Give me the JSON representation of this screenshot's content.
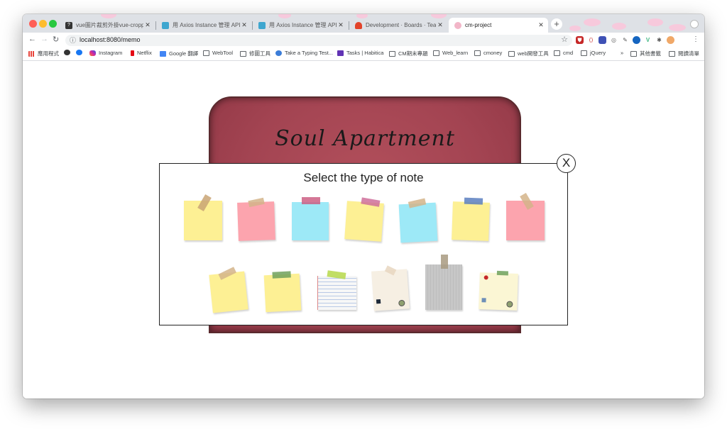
{
  "browser": {
    "tabs": [
      {
        "title": "vue圖片裁剪外掛vue-cropper的",
        "favicon_color": "#333333",
        "favicon_glyph": "?"
      },
      {
        "title": "用 Axios Instance 管理 API - IT",
        "favicon_color": "#3ea6cf",
        "favicon_glyph": ""
      },
      {
        "title": "用 Axios Instance 管理 API - IT",
        "favicon_color": "#3ea6cf",
        "favicon_glyph": ""
      },
      {
        "title": "Development · Boards · Team",
        "favicon_color": "#e2432a",
        "favicon_glyph": ""
      },
      {
        "title": "cm-project",
        "favicon_color": "#f2b6c8",
        "favicon_glyph": ""
      }
    ],
    "new_tab_label": "+",
    "url": "localhost:8080/memo",
    "bookmarks": [
      {
        "label": "應用程式",
        "icon": "apps-grid-icon",
        "color": "#e8453c"
      },
      {
        "label": "",
        "icon": "compass-icon",
        "color": "#333333"
      },
      {
        "label": "",
        "icon": "facebook-icon",
        "color": "#1877f2"
      },
      {
        "label": "Instagram",
        "icon": "instagram-icon",
        "color": "#d6249f"
      },
      {
        "label": "Netflix",
        "icon": "netflix-icon",
        "color": "#e50914"
      },
      {
        "label": "Google 翻譯",
        "icon": "translate-icon",
        "color": "#4285f4"
      },
      {
        "label": "WebTool",
        "icon": "folder-icon",
        "color": "#5f6368"
      },
      {
        "label": "修圖工具",
        "icon": "folder-icon",
        "color": "#5f6368"
      },
      {
        "label": "Take a Typing Test...",
        "icon": "typing-icon",
        "color": "#3b7dd8"
      },
      {
        "label": "Tasks | Habitica",
        "icon": "habitica-icon",
        "color": "#6133b4"
      },
      {
        "label": "CM期末專題",
        "icon": "folder-icon",
        "color": "#5f6368"
      },
      {
        "label": "Web_learn",
        "icon": "folder-icon",
        "color": "#5f6368"
      },
      {
        "label": "cmoney",
        "icon": "folder-icon",
        "color": "#5f6368"
      },
      {
        "label": "web開發工具",
        "icon": "folder-icon",
        "color": "#5f6368"
      },
      {
        "label": "cmd",
        "icon": "folder-icon",
        "color": "#5f6368"
      },
      {
        "label": "jQuery",
        "icon": "folder-icon",
        "color": "#5f6368"
      },
      {
        "label": "»",
        "icon": "",
        "color": "#5f6368"
      },
      {
        "label": "其他書籤",
        "icon": "folder-icon",
        "color": "#5f6368"
      },
      {
        "label": "閱讀清單",
        "icon": "reading-list-icon",
        "color": "#5f6368"
      }
    ]
  },
  "page": {
    "book_title": "Soul Apartment",
    "modal": {
      "title": "Select the type of note",
      "close_label": "X"
    },
    "notes": [
      {
        "name": "note-yellow-1",
        "color": "#fdf094",
        "tape": "#c9a574"
      },
      {
        "name": "note-pink-1",
        "color": "#fca4ae",
        "tape": "#d4b48a"
      },
      {
        "name": "note-cyan-1",
        "color": "#9de9f7",
        "tape": "#cd5f84"
      },
      {
        "name": "note-yellow-2",
        "color": "#fdf094",
        "tape": "#cf6f9a"
      },
      {
        "name": "note-cyan-2",
        "color": "#9de9f7",
        "tape": "#d4b48a"
      },
      {
        "name": "note-yellow-3",
        "color": "#fdf094",
        "tape": "#5a7fc0"
      },
      {
        "name": "note-pink-2",
        "color": "#fca4ae",
        "tape": "#d4b48a"
      },
      {
        "name": "note-yellow-4",
        "color": "#fdf094",
        "tape": "#d4b48a"
      },
      {
        "name": "note-yellow-5",
        "color": "#fdf094",
        "tape": "#6fa15c"
      },
      {
        "name": "note-lined-paper",
        "color": "#f7f7f7",
        "tape": "#b6d84a"
      },
      {
        "name": "note-cream-paper",
        "color": "#f6efe3",
        "tape": "#e8d6c0"
      },
      {
        "name": "note-grey-paper",
        "color": "#c7c7c7",
        "tape": "#a89a80"
      },
      {
        "name": "note-pinned-paper",
        "color": "#fbf6d4",
        "tape": "#6fa15c"
      }
    ]
  }
}
